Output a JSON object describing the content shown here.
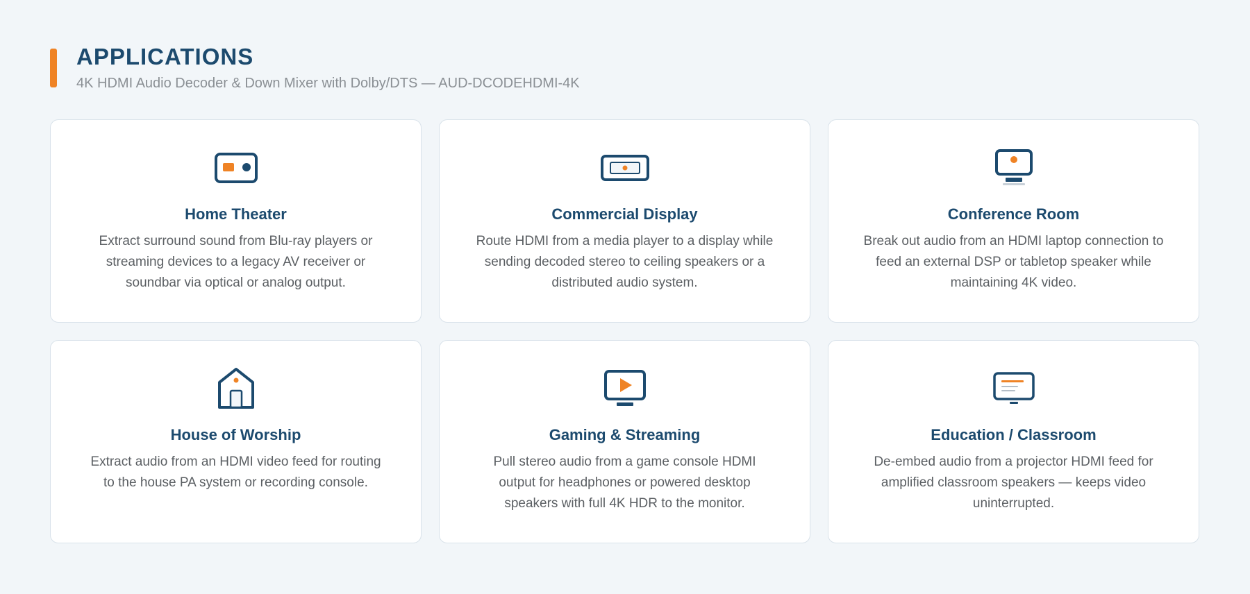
{
  "header": {
    "title": "APPLICATIONS",
    "subtitle": "4K HDMI Audio Decoder & Down Mixer with Dolby/DTS — AUD-DCODEHDMI-4K"
  },
  "colors": {
    "accent": "#ef8325",
    "navy": "#1c4a6e",
    "background": "#f2f6f9"
  },
  "cards": [
    {
      "icon": "receiver-icon",
      "title": "Home Theater",
      "description": "Extract surround sound from Blu-ray players or streaming devices to a legacy AV receiver or soundbar via optical or analog output."
    },
    {
      "icon": "display-panel-icon",
      "title": "Commercial Display",
      "description": "Route HDMI from a media player to a display while sending decoded stereo to ceiling speakers or a distributed audio system."
    },
    {
      "icon": "monitor-icon",
      "title": "Conference Room",
      "description": "Break out audio from an HDMI laptop connection to feed an external DSP or tabletop speaker while maintaining 4K video."
    },
    {
      "icon": "house-icon",
      "title": "House of Worship",
      "description": "Extract audio from an HDMI video feed for routing to the house PA system or recording console."
    },
    {
      "icon": "play-screen-icon",
      "title": "Gaming & Streaming",
      "description": "Pull stereo audio from a game console HDMI output for headphones or powered desktop speakers with full 4K HDR to the monitor."
    },
    {
      "icon": "presentation-screen-icon",
      "title": "Education / Classroom",
      "description": "De-embed audio from a projector HDMI feed for amplified classroom speakers — keeps video uninterrupted."
    }
  ]
}
